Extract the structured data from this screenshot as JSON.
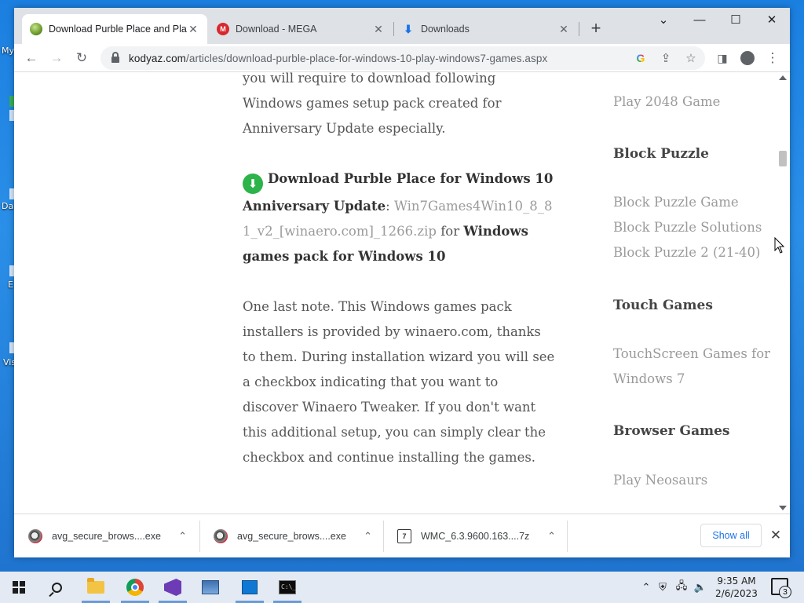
{
  "desktop": {
    "icon_labels": [
      "My",
      "Da",
      "E",
      "Vis"
    ]
  },
  "browser": {
    "tabs": [
      {
        "title": "Download Purble Place and Play",
        "active": true,
        "favicon": "purble-place-icon"
      },
      {
        "title": "Download - MEGA",
        "active": false,
        "favicon": "mega-icon"
      },
      {
        "title": "Downloads",
        "active": false,
        "favicon": "download-icon"
      }
    ],
    "new_tab_icon": "plus-icon",
    "window_controls": {
      "dropdown": "⌄",
      "minimize": "—",
      "maximize": "☐",
      "close": "✕"
    },
    "nav": {
      "back": "←",
      "forward": "→",
      "reload": "↻"
    },
    "url_host": "kodyaz.com",
    "url_path": "/articles/download-purble-place-for-windows-10-play-windows7-games.aspx",
    "omnibox_icons": [
      "google-icon",
      "share-icon",
      "bookmark-star-icon"
    ],
    "toolbar_icons": [
      "side-panel-icon",
      "profile-icon",
      "menu-icon"
    ]
  },
  "article": {
    "intro": "you will require to download following Windows games setup pack created for Anniversary Update especially.",
    "download_heading": "Download Purble Place for Windows 10 Anniversary Update",
    "colon": ":",
    "download_link": "Win7Games4Win10_8_81_v2_[winaero.com]_1266.zip",
    "for_text": "for",
    "pack_label": "Windows games pack for Windows 10",
    "note": "One last note. This Windows games pack installers is provided by winaero.com, thanks to them. During installation wizard you will see a checkbox indicating that you want to discover Winaero Tweaker. If you don't want this additional setup, you can simply clear the checkbox and continue installing the games."
  },
  "sidebar": {
    "top_link": "Play 2048 Game",
    "sections": [
      {
        "heading": "Block Puzzle",
        "links": [
          "Block Puzzle Game",
          "Block Puzzle Solutions",
          "Block Puzzle 2 (21-40)"
        ]
      },
      {
        "heading": "Touch Games",
        "links": [
          "TouchScreen Games for Windows 7"
        ]
      },
      {
        "heading": "Browser Games",
        "links": [
          "Play Neosaurs"
        ]
      }
    ]
  },
  "downloads": {
    "items": [
      {
        "name": "avg_secure_brows....exe",
        "icon": "avg-installer-icon"
      },
      {
        "name": "avg_secure_brows....exe",
        "icon": "avg-installer-icon"
      },
      {
        "name": "WMC_6.3.9600.163....7z",
        "icon": "7z-archive-icon"
      }
    ],
    "show_all": "Show all"
  },
  "taskbar": {
    "apps": [
      "start-icon",
      "search-icon",
      "file-explorer-icon",
      "chrome-icon",
      "visual-studio-icon",
      "app-icon",
      "remote-desktop-icon",
      "command-prompt-icon"
    ],
    "time": "9:35 AM",
    "date": "2/6/2023",
    "notification_count": "3"
  },
  "colors": {
    "download_green": "#2cb34a",
    "link_gray": "#9a9a9a",
    "accent_blue": "#1a73e8"
  }
}
